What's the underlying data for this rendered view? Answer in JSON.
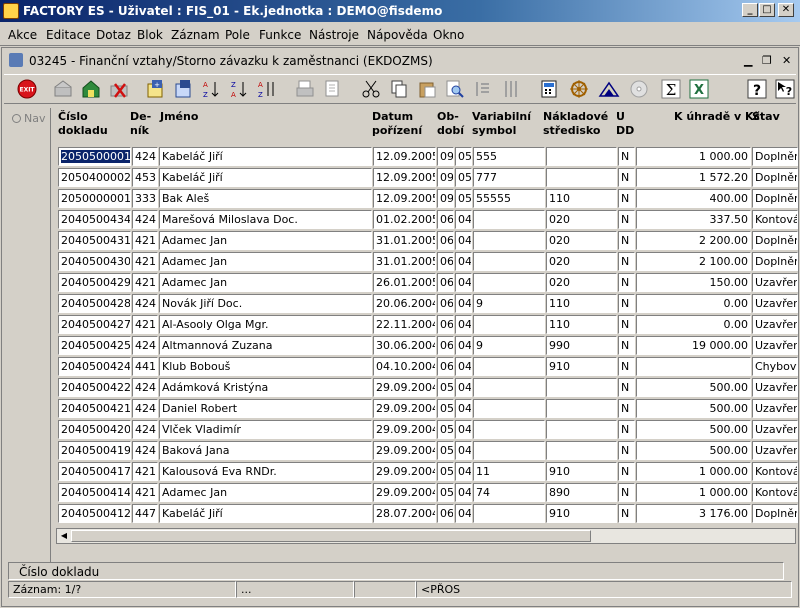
{
  "app": {
    "title": "FACTORY ES - Uživatel : FIS_01 - Ek.jednotka : DEMO@fisdemo"
  },
  "menu": [
    "Akce",
    "Editace",
    "Dotaz",
    "Blok",
    "Záznam",
    "Pole",
    "Funkce",
    "Nástroje",
    "Nápověda",
    "Okno"
  ],
  "form": {
    "title": "03245 - Finanční vztahy/Storno závazku k zaměstnanci (EKDOZMS)"
  },
  "toolbar": [
    "exit-icon",
    "enter-query-icon",
    "execute-query-icon",
    "cancel-query-icon",
    "insert-record-icon",
    "delete-record-icon",
    "sort-asc-icon",
    "sort-desc-icon",
    "multi-sort-icon",
    "print-icon",
    "print-preview-icon",
    "cut-icon",
    "copy-icon",
    "paste-icon",
    "find-icon",
    "list-icon",
    "columns-icon",
    "calculator-icon",
    "wheel-icon",
    "triangle-icon",
    "disk-icon",
    "sum-icon",
    "excel-icon",
    "help-icon",
    "context-help-icon"
  ],
  "nav": {
    "label": "Nav"
  },
  "columns": [
    {
      "l1": "Číslo",
      "l2": "dokladu"
    },
    {
      "l1": "De-",
      "l2": "ník"
    },
    {
      "l1": "",
      "l2": "Jméno"
    },
    {
      "l1": "Datum",
      "l2": "pořízení"
    },
    {
      "l1": "Ob-",
      "l2": "dobí"
    },
    {
      "l1": "Variabilní",
      "l2": "symbol"
    },
    {
      "l1": "Nákladové",
      "l2": "středisko"
    },
    {
      "l1": "U",
      "l2": "DD"
    },
    {
      "l1": "",
      "l2": "K úhradě v Kč"
    },
    {
      "l1": "",
      "l2": "Stav"
    }
  ],
  "rows": [
    [
      "2050500001",
      "424",
      "Kabeláč Jiří",
      "12.09.2005",
      "09",
      "05",
      "555",
      "",
      "N",
      "1 000.00",
      "Doplněn"
    ],
    [
      "2050400002",
      "453",
      "Kabeláč Jiří",
      "12.09.2005",
      "09",
      "05",
      "777",
      "",
      "N",
      "1 572.20",
      "Doplněn"
    ],
    [
      "2050000001",
      "333",
      "Bak Aleš",
      "12.09.2005",
      "09",
      "05",
      "55555",
      "110",
      "N",
      "400.00",
      "Doplněn"
    ],
    [
      "2040500434",
      "424",
      "Marešová Miloslava Doc.",
      "01.02.2005",
      "06",
      "04",
      "",
      "020",
      "N",
      "337.50",
      "Kontová"
    ],
    [
      "2040500431",
      "421",
      "Adamec Jan",
      "31.01.2005",
      "06",
      "04",
      "",
      "020",
      "N",
      "2 200.00",
      "Doplněn"
    ],
    [
      "2040500430",
      "421",
      "Adamec Jan",
      "31.01.2005",
      "06",
      "04",
      "",
      "020",
      "N",
      "2 100.00",
      "Doplněn"
    ],
    [
      "2040500429",
      "421",
      "Adamec Jan",
      "26.01.2005",
      "06",
      "04",
      "",
      "020",
      "N",
      "150.00",
      "Uzavřen"
    ],
    [
      "2040500428",
      "424",
      "Novák Jiří Doc.",
      "20.06.2004",
      "06",
      "04",
      "9",
      "110",
      "N",
      "0.00",
      "Uzavřen"
    ],
    [
      "2040500427",
      "421",
      "Al-Asooly Olga Mgr.",
      "22.11.2004",
      "06",
      "04",
      "",
      "110",
      "N",
      "0.00",
      "Uzavřen"
    ],
    [
      "2040500425",
      "424",
      "Altmannová Zuzana",
      "30.06.2004",
      "06",
      "04",
      "9",
      "990",
      "N",
      "19 000.00",
      "Uzavřen"
    ],
    [
      "2040500424",
      "441",
      "Klub Bobouš",
      "04.10.2004",
      "06",
      "04",
      "",
      "910",
      "N",
      "",
      "Chybový"
    ],
    [
      "2040500422",
      "424",
      "Adámková Kristýna",
      "29.09.2004",
      "05",
      "04",
      "",
      "",
      "N",
      "500.00",
      "Uzavřen"
    ],
    [
      "2040500421",
      "424",
      "Daniel Robert",
      "29.09.2004",
      "05",
      "04",
      "",
      "",
      "N",
      "500.00",
      "Uzavřen"
    ],
    [
      "2040500420",
      "424",
      "Vlček Vladimír",
      "29.09.2004",
      "05",
      "04",
      "",
      "",
      "N",
      "500.00",
      "Uzavřen"
    ],
    [
      "2040500419",
      "424",
      "Baková Jana",
      "29.09.2004",
      "05",
      "04",
      "",
      "",
      "N",
      "500.00",
      "Uzavřen"
    ],
    [
      "2040500417",
      "421",
      "Kalousová Eva RNDr.",
      "29.09.2004",
      "05",
      "04",
      "11",
      "910",
      "N",
      "1 000.00",
      "Kontová"
    ],
    [
      "2040500414",
      "421",
      "Adamec Jan",
      "29.09.2004",
      "05",
      "04",
      "74",
      "890",
      "N",
      "1 000.00",
      "Kontová"
    ],
    [
      "2040500412",
      "447",
      "Kabeláč Jiří",
      "28.07.2004",
      "06",
      "04",
      "",
      "910",
      "N",
      "3 176.00",
      "Doplněn"
    ]
  ],
  "status": {
    "hint": "Číslo dokladu",
    "record": "Záznam: 1/?",
    "seg2": "...",
    "seg3": "<PŘOS"
  }
}
